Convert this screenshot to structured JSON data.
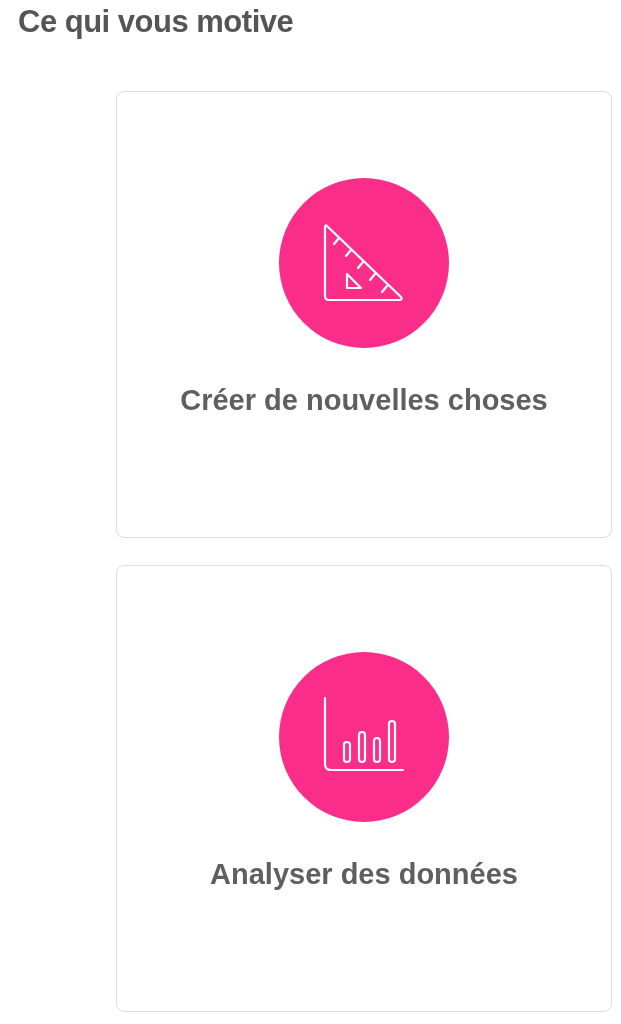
{
  "title": "Ce qui vous motive",
  "options": [
    {
      "kind": "ruler",
      "label": "Créer de nouvelles choses"
    },
    {
      "kind": "chart",
      "label": "Analyser des données"
    }
  ]
}
